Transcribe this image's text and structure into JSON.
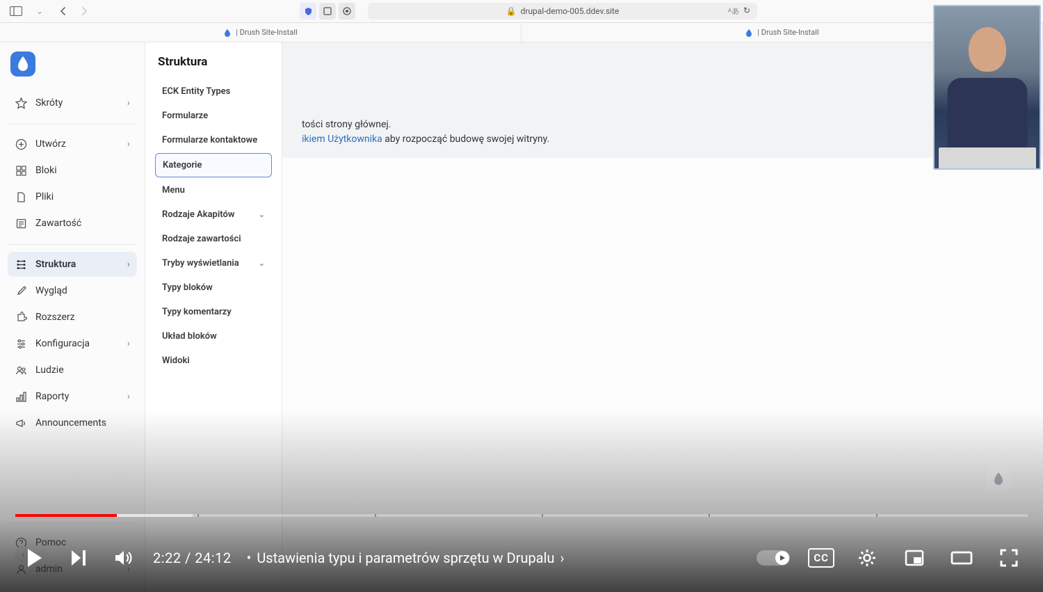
{
  "browser": {
    "url_display": "drupal-demo-005.ddev.site",
    "tabs": [
      {
        "label": "| Drush Site-Install"
      },
      {
        "label": "| Drush Site-Install"
      }
    ]
  },
  "sidebar": {
    "items": [
      {
        "icon": "star",
        "label": "Skróty",
        "chevron": true
      },
      {
        "icon": "plus-circle",
        "label": "Utwórz",
        "chevron": true
      },
      {
        "icon": "blocks",
        "label": "Bloki",
        "chevron": false
      },
      {
        "icon": "file",
        "label": "Pliki",
        "chevron": false
      },
      {
        "icon": "content",
        "label": "Zawartość",
        "chevron": false
      },
      {
        "icon": "structure",
        "label": "Struktura",
        "chevron": true,
        "active": true
      },
      {
        "icon": "brush",
        "label": "Wygląd",
        "chevron": false
      },
      {
        "icon": "puzzle",
        "label": "Rozszerz",
        "chevron": false
      },
      {
        "icon": "sliders",
        "label": "Konfiguracja",
        "chevron": true
      },
      {
        "icon": "people",
        "label": "Ludzie",
        "chevron": false
      },
      {
        "icon": "reports",
        "label": "Raporty",
        "chevron": true
      },
      {
        "icon": "megaphone",
        "label": "Announcements",
        "chevron": false
      }
    ],
    "bottom": [
      {
        "icon": "help",
        "label": "Pomoc",
        "chevron": false
      },
      {
        "icon": "user",
        "label": "admin",
        "chevron": true
      }
    ]
  },
  "submenu": {
    "title": "Struktura",
    "items": [
      {
        "label": "ECK Entity Types",
        "chevron": false
      },
      {
        "label": "Formularze",
        "chevron": false
      },
      {
        "label": "Formularze kontaktowe",
        "chevron": false
      },
      {
        "label": "Kategorie",
        "chevron": false,
        "highlighted": true
      },
      {
        "label": "Menu",
        "chevron": false
      },
      {
        "label": "Rodzaje Akapitów",
        "chevron": true
      },
      {
        "label": "Rodzaje zawartości",
        "chevron": false
      },
      {
        "label": "Tryby wyświetlania",
        "chevron": true
      },
      {
        "label": "Typy bloków",
        "chevron": false
      },
      {
        "label": "Typy komentarzy",
        "chevron": false
      },
      {
        "label": "Układ bloków",
        "chevron": false
      },
      {
        "label": "Widoki",
        "chevron": false
      }
    ]
  },
  "content": {
    "partial_text_1": "tości strony głównej.",
    "link_text": "ikiem Użytkownika",
    "partial_text_2": " aby rozpocząć budowę swojej witryny."
  },
  "player": {
    "current_time": "2:22",
    "total_time": "24:12",
    "chapter_label": "Ustawienia typu i parametrów sprzętu w Drupalu",
    "cc_label": "CC"
  }
}
